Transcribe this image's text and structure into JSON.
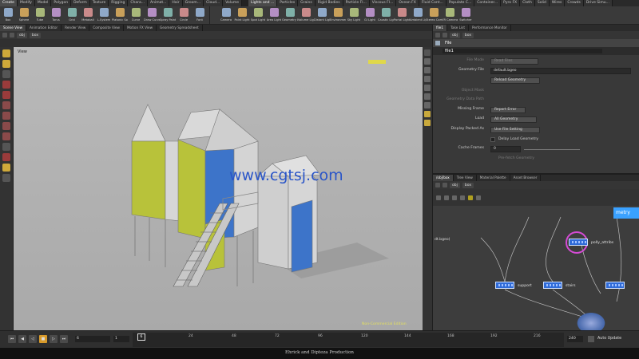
{
  "shelf_tabs_left": [
    "Create",
    "Modify",
    "Model",
    "Polygon",
    "Deform",
    "Texture",
    "Rigging",
    "Chara...",
    "Animat...",
    "Hair",
    "Groom...",
    "Cloud...",
    "Volume"
  ],
  "shelf_tabs_right": [
    "Lights and ...",
    "Particles",
    "Grains",
    "Rigid Bodies",
    "Particle Fl...",
    "Viscous Fl...",
    "Ocean FX",
    "Fluid Cont...",
    "Populate C...",
    "Container...",
    "Pyro FX",
    "Cloth",
    "Solid",
    "Wires",
    "Crowds",
    "Drive Simu..."
  ],
  "tools_left": [
    "Box",
    "Sphere",
    "Tube",
    "Torus",
    "Grid",
    "Metaball",
    "L-System",
    "Platonic Sol...",
    "Curve",
    "Draw Curve",
    "Spray Paint",
    "Circle",
    "Font"
  ],
  "tools_right": [
    "Camera",
    "Point Light",
    "Spot Light",
    "Area Light",
    "Geometry L...",
    "Volume Light",
    "Distant Light",
    "Environmen...",
    "Sky Light",
    "GI Light",
    "Caustic Light",
    "Portal Light",
    "Ambient Lig...",
    "Stereo Cam...",
    "VR Camera",
    "Switcher"
  ],
  "viewer_tabs": [
    "Scene View",
    "Animation Editor",
    "Render View",
    "Composite View",
    "Motion FX View",
    "Geometry Spreadsheet"
  ],
  "param_tabs": [
    "file1",
    "Take List",
    "Performance Monitor"
  ],
  "network_tabs": [
    "/obj/box",
    "Tree View",
    "Material Palette",
    "Asset Browser"
  ],
  "path": {
    "obj": "obj",
    "box": "box"
  },
  "viewport": {
    "label": "View",
    "watermark": "www.cgtsj.com",
    "edition": "Non-Commercial Edition"
  },
  "params": {
    "node_type": "File",
    "node_name": "file1",
    "file_mode_label": "File Mode",
    "file_mode_value": "Read Files",
    "geometry_file_label": "Geometry File",
    "geometry_file_value": "default.bgeo",
    "reload_button": "Reload Geometry",
    "object_mask_label": "Object Mask",
    "data_path_label": "Geometry Data Path",
    "missing_frame_label": "Missing Frame",
    "missing_frame_value": "Report Error",
    "load_label": "Load",
    "load_value": "All Geometry",
    "packed_label": "Display Packed As",
    "packed_value": "Use File Setting",
    "delay_label": "Delay Load Geometry",
    "cache_label": "Cache Frames",
    "cache_value": "0",
    "prefetch_label": "Pre-fetch Geometry"
  },
  "network": {
    "header": "metry",
    "node_attrib": "polly_attribs",
    "node_support": "support",
    "node_stairs": "stairs",
    "partial_label": "dt.bgeo)"
  },
  "timeline": {
    "current_frame": "6",
    "start_frame": "1",
    "frame_marker": "6",
    "ticks": [
      "24",
      "48",
      "72",
      "96",
      "120",
      "144",
      "168",
      "192",
      "216"
    ],
    "end_frame": "240",
    "auto_update": "Auto Update"
  },
  "status_text": "Ehrick and Dipteza Production",
  "colors": {
    "panel": "#393939",
    "accent": "#2f6bd8",
    "house_yellow": "#b8c23a",
    "house_blue": "#3d74c9"
  }
}
